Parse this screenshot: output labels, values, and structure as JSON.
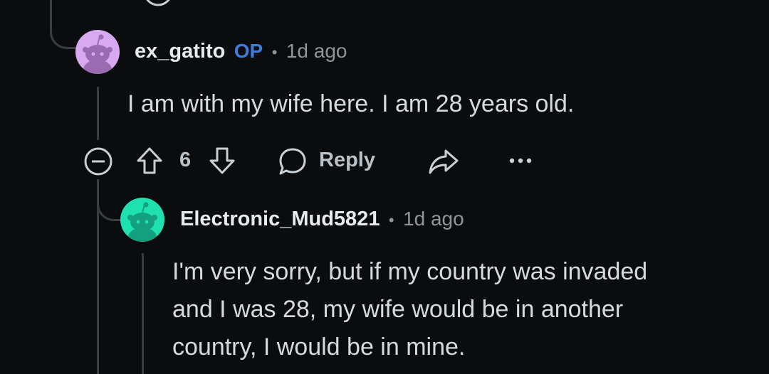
{
  "colors": {
    "background": "#0b0c0d",
    "thread_line": "#3a3d40",
    "op_badge": "#3d7dd8",
    "avatar_op": "#d9a9f0",
    "avatar_reply": "#1fe0b0"
  },
  "comment": {
    "username": "ex_gatito",
    "op_badge": "OP",
    "separator": "•",
    "time": "1d ago",
    "body": "I am with my wife here. I am 28 years old.",
    "vote_count": "6",
    "reply_label": "Reply",
    "icons": [
      "collapse-icon",
      "upvote-icon",
      "downvote-icon",
      "comment-bubble-icon",
      "share-icon",
      "more-icon"
    ]
  },
  "reply": {
    "username": "Electronic_Mud5821",
    "separator": "•",
    "time": "1d ago",
    "body_lines": [
      "I'm very sorry, but if my country was invaded",
      "and I was 28, my wife would be in another",
      "country, I would be in mine."
    ]
  }
}
